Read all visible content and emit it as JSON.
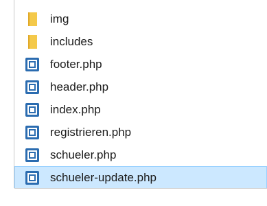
{
  "file_list": {
    "items": [
      {
        "name": "img",
        "type": "folder",
        "icon": "folder-icon"
      },
      {
        "name": "includes",
        "type": "folder",
        "icon": "folder-icon"
      },
      {
        "name": "footer.php",
        "type": "file",
        "icon": "php-file-icon"
      },
      {
        "name": "header.php",
        "type": "file",
        "icon": "php-file-icon"
      },
      {
        "name": "index.php",
        "type": "file",
        "icon": "php-file-icon"
      },
      {
        "name": "registrieren.php",
        "type": "file",
        "icon": "php-file-icon"
      },
      {
        "name": "schueler.php",
        "type": "file",
        "icon": "php-file-icon"
      },
      {
        "name": "schueler-update.php",
        "type": "file",
        "icon": "php-file-icon",
        "selected": true
      }
    ]
  },
  "colors": {
    "folder": "#f4c94a",
    "folder_dark": "#e0a92a",
    "file_icon": "#2b6cb0",
    "selection_bg": "#cce8ff",
    "selection_border": "#99d1ff"
  }
}
